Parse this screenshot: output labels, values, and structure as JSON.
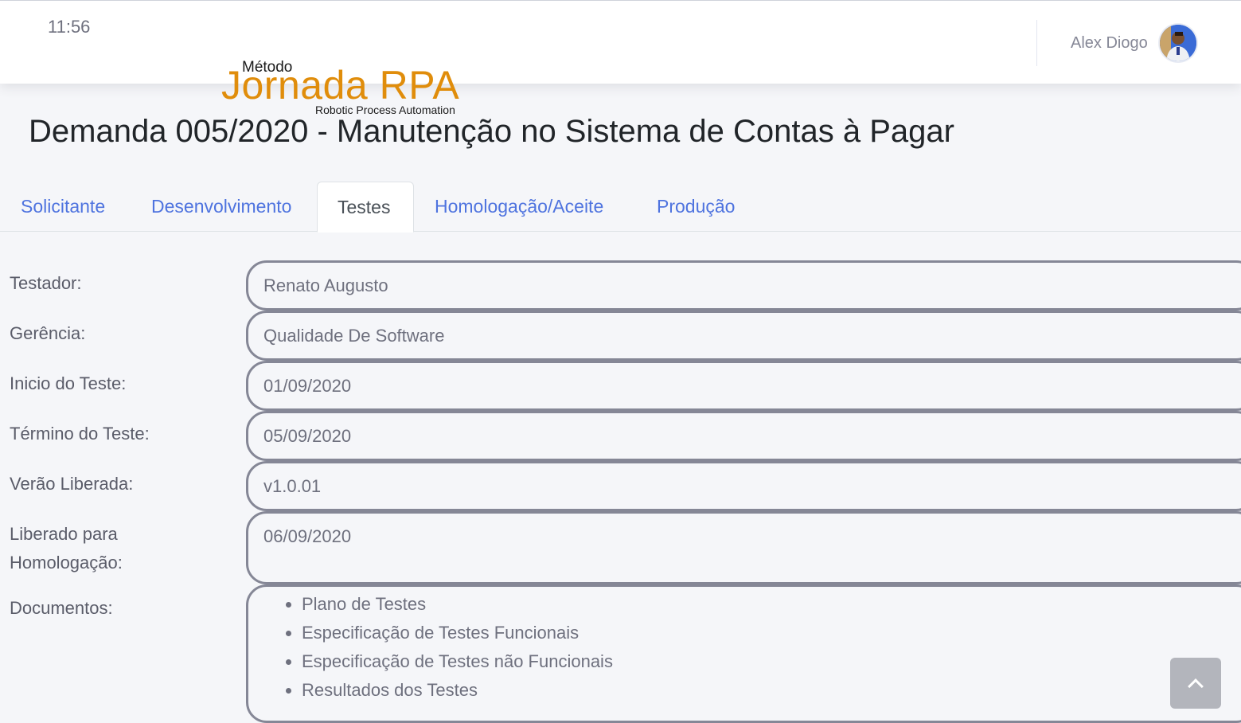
{
  "topbar": {
    "time": "11:56",
    "user_name": "Alex Diogo"
  },
  "logo": {
    "metodo": "Método",
    "jornada": "Jornada RPA",
    "tagline": "Robotic Process Automation"
  },
  "page": {
    "title": "Demanda 005/2020 - Manutenção no Sistema de Contas à Pagar"
  },
  "tabs": [
    {
      "label": "Solicitante"
    },
    {
      "label": "Desenvolvimento"
    },
    {
      "label": "Testes"
    },
    {
      "label": "Homologação/Aceite"
    },
    {
      "label": "Produção"
    }
  ],
  "form": {
    "testador": {
      "label": "Testador:",
      "value": "Renato Augusto"
    },
    "gerencia": {
      "label": "Gerência:",
      "value": "Qualidade De Software"
    },
    "inicio": {
      "label": "Inicio do Teste:",
      "value": "01/09/2020"
    },
    "termino": {
      "label": "Término do Teste:",
      "value": "05/09/2020"
    },
    "versao": {
      "label": "Verão Liberada:",
      "value": "v1.0.01"
    },
    "liberado": {
      "label_line1": "Liberado para",
      "label_line2": "Homologação:",
      "value": "06/09/2020"
    },
    "documentos": {
      "label": "Documentos:",
      "items": [
        "Plano de Testes",
        "Especificação de Testes Funcionais",
        "Especificação de Testes não Funcionais",
        "Resultados dos Testes"
      ]
    }
  },
  "icons": {
    "scroll_top": "chevron-up-icon"
  }
}
